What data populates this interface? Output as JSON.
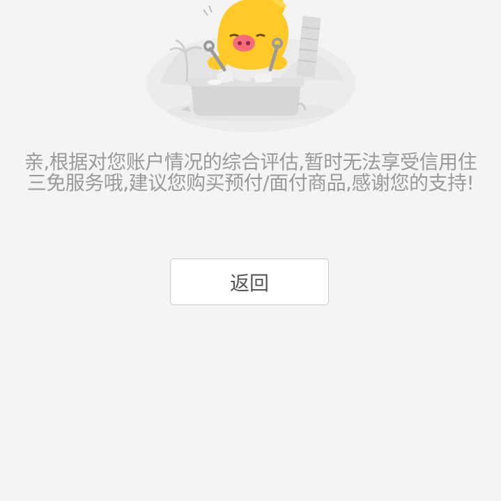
{
  "illustration": {
    "icon": "mascot-pig-mechanic-illustration",
    "colors": {
      "mascot": "#ffc928",
      "nose": "#f56b7b",
      "scenery": "#e2e2e2"
    }
  },
  "message": {
    "text": "亲,根据对您账户情况的综合评估,暂时无法享受信用住三免服务哦,建议您购买预付/面付商品,感谢您的支持!"
  },
  "actions": {
    "back_label": "返回"
  }
}
